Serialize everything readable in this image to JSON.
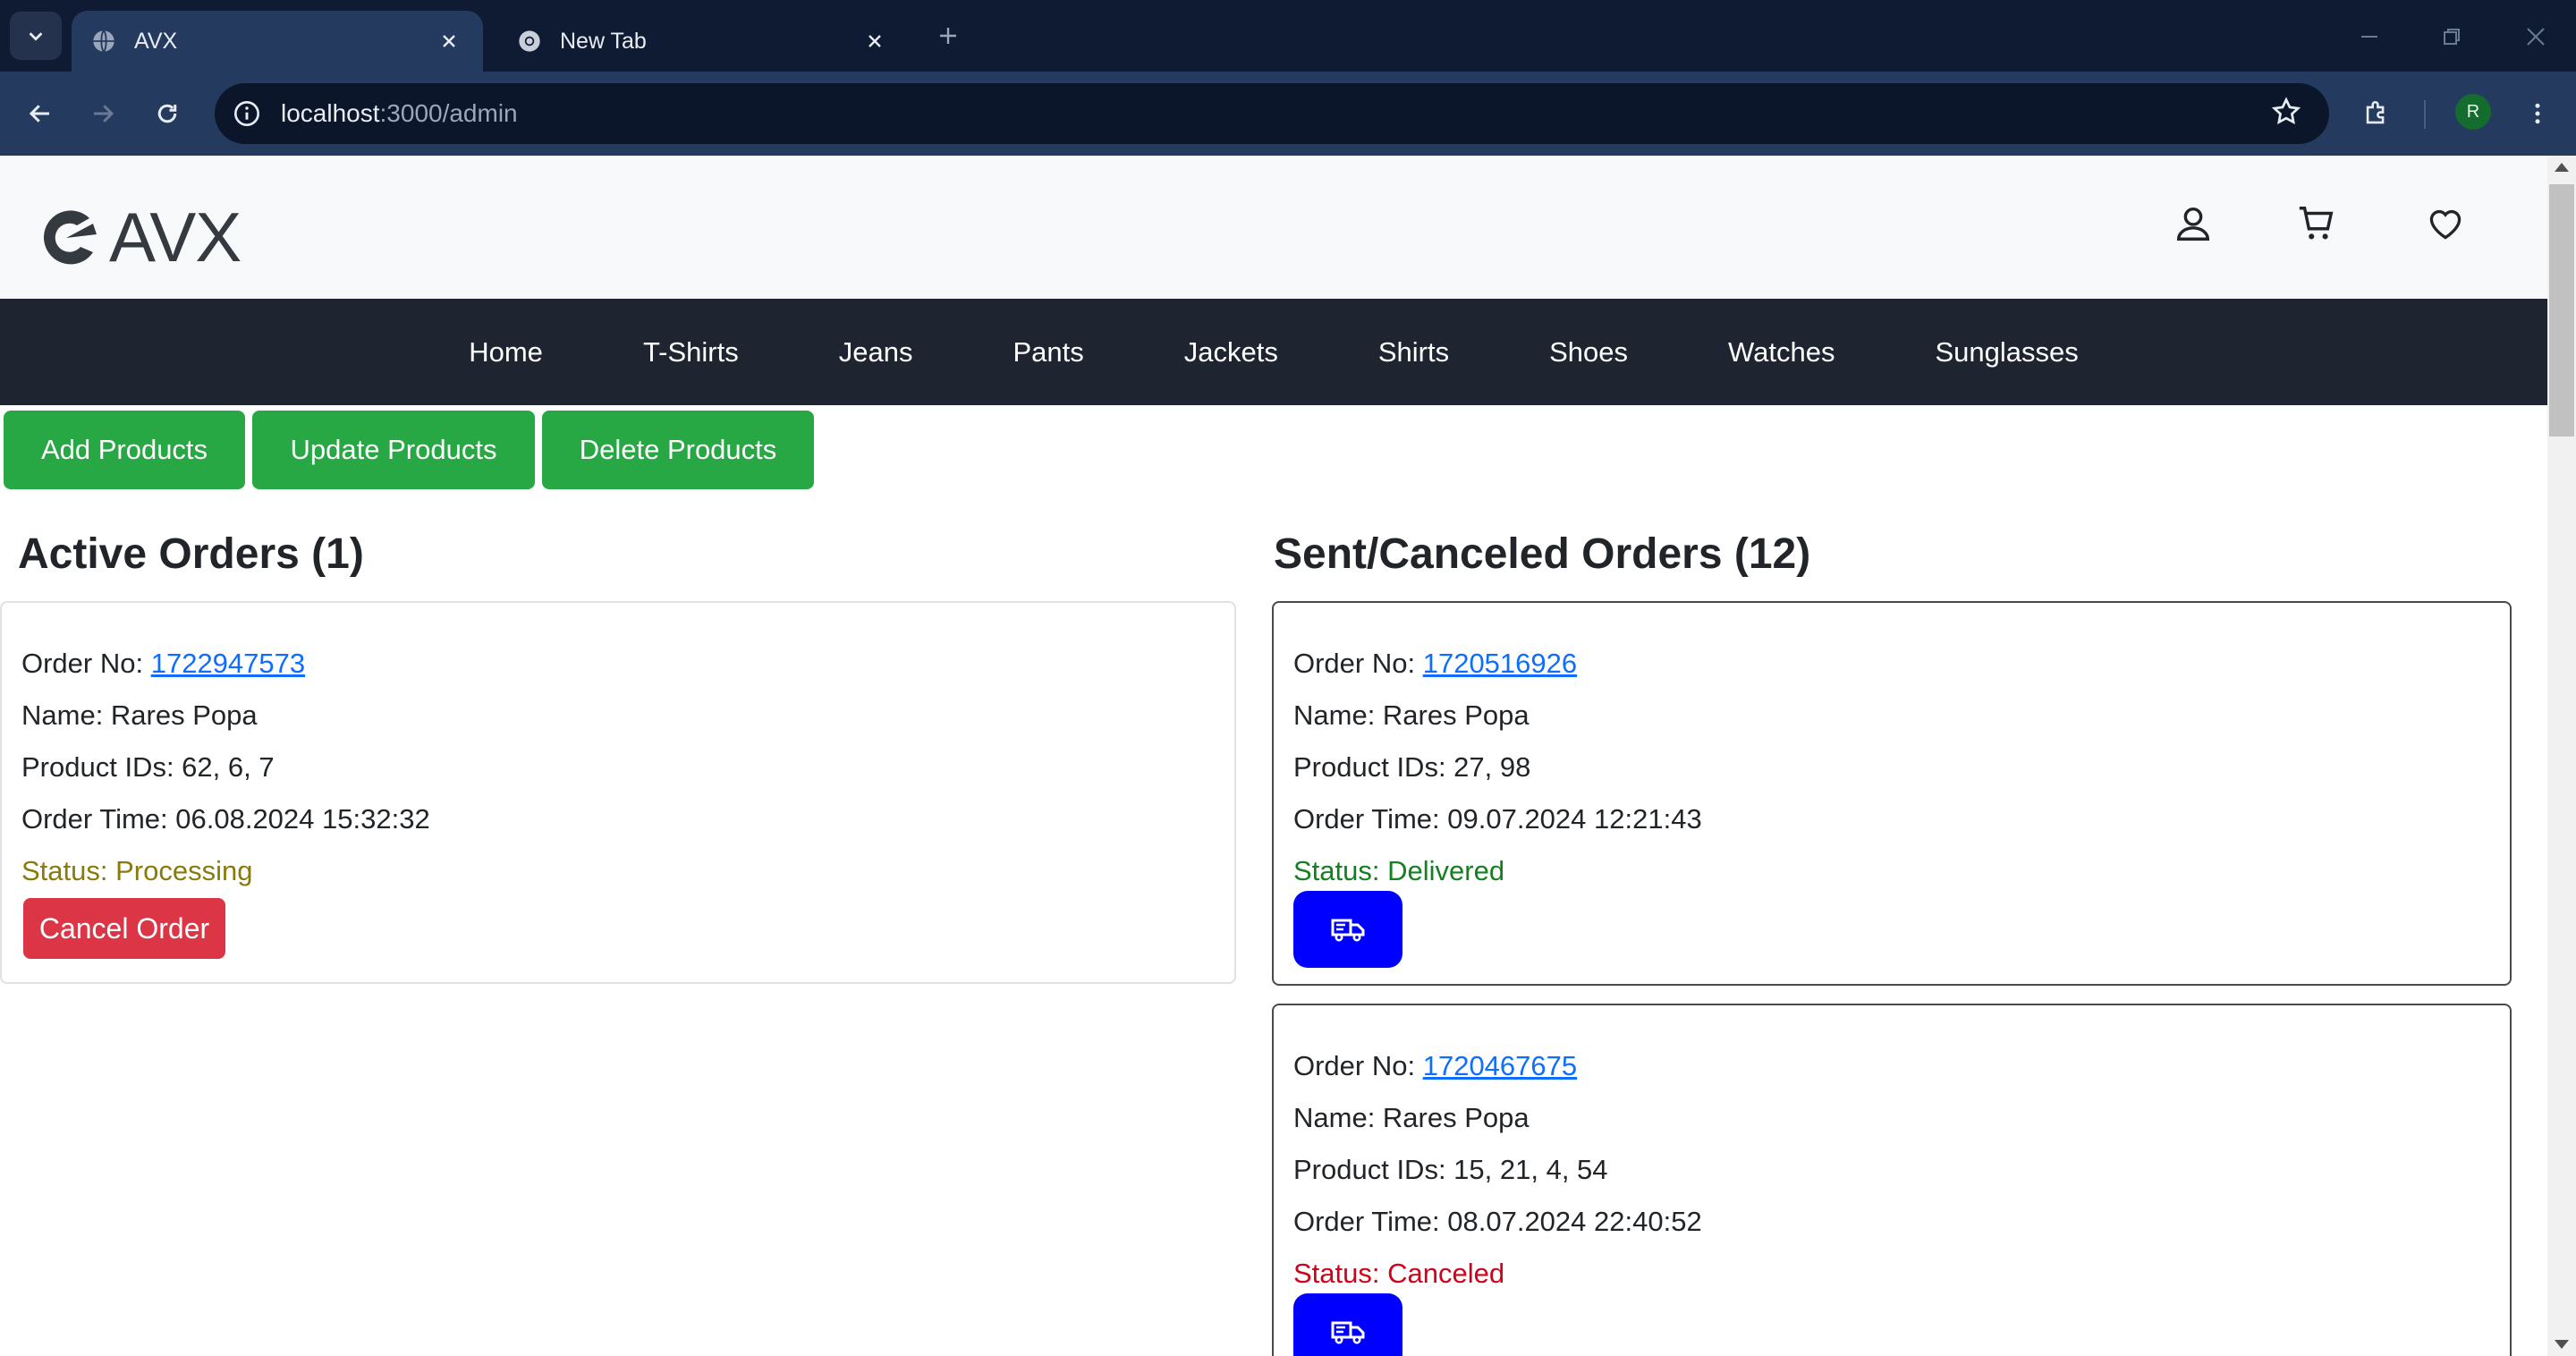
{
  "browser": {
    "tabs": [
      {
        "title": "AVX",
        "active": true,
        "icon": "globe-icon"
      },
      {
        "title": "New Tab",
        "active": false,
        "icon": "chrome-icon"
      }
    ],
    "url_host": "localhost",
    "url_path": ":3000/admin",
    "profile_initial": "R"
  },
  "site": {
    "logo_text": "AVX",
    "header_icons": [
      "user-icon",
      "cart-icon",
      "heart-icon"
    ],
    "nav": [
      "Home",
      "T-Shirts",
      "Jeans",
      "Pants",
      "Jackets",
      "Shirts",
      "Shoes",
      "Watches",
      "Sunglasses"
    ]
  },
  "admin_actions": {
    "add": "Add Products",
    "update": "Update Products",
    "delete": "Delete Products"
  },
  "active_orders": {
    "title": "Active Orders (1)",
    "orders": [
      {
        "order_label": "Order No: ",
        "order_no": "1722947573",
        "name": "Name: Rares Popa",
        "products": "Product IDs: 62, 6, 7",
        "time": "Order Time: 06.08.2024 15:32:32",
        "status": "Status: Processing",
        "action": "Cancel Order"
      }
    ]
  },
  "sent_orders": {
    "title": "Sent/Canceled Orders (12)",
    "orders": [
      {
        "order_label": "Order No: ",
        "order_no": "1720516926",
        "name": "Name: Rares Popa",
        "products": "Product IDs: 27, 98",
        "time": "Order Time: 09.07.2024 12:21:43",
        "status": "Status: Delivered"
      },
      {
        "order_label": "Order No: ",
        "order_no": "1720467675",
        "name": "Name: Rares Popa",
        "products": "Product IDs: 15, 21, 4, 54",
        "time": "Order Time: 08.07.2024 22:40:52",
        "status": "Status: Canceled"
      }
    ]
  },
  "colors": {
    "nav_bg": "#1e2531",
    "green_button": "#28a745",
    "red_button": "#dc3545",
    "ship_button": "#0000ff",
    "link": "#0d6efd"
  }
}
